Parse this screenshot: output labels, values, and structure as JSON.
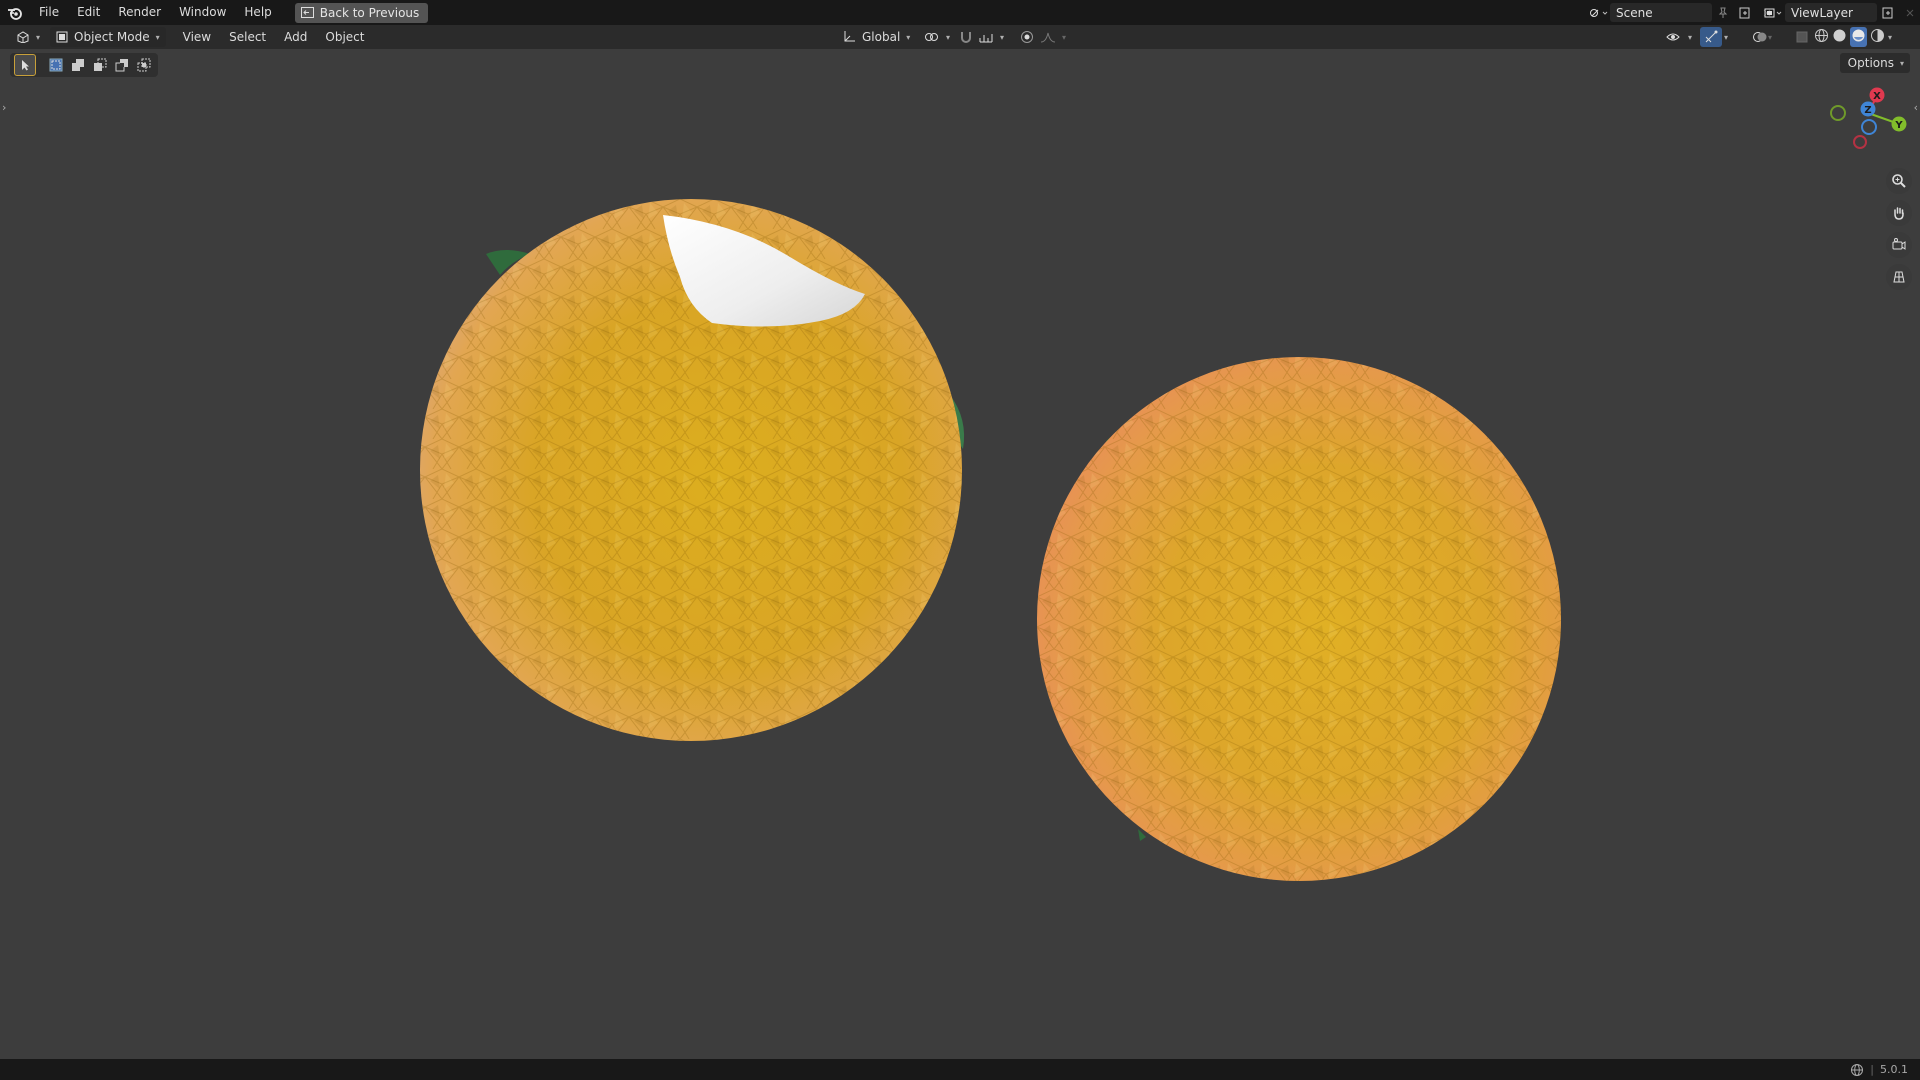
{
  "topbar": {
    "menus": [
      "File",
      "Edit",
      "Render",
      "Window",
      "Help"
    ],
    "back_button": "Back to Previous",
    "scene": "Scene",
    "view_layer": "ViewLayer"
  },
  "header": {
    "mode": "Object Mode",
    "menus": [
      "View",
      "Select",
      "Add",
      "Object"
    ],
    "orientation": "Global"
  },
  "viewport": {
    "options_label": "Options",
    "gizmo": {
      "x": "X",
      "y": "Y",
      "z": "Z"
    },
    "objects": [
      "textured orange with peel cut",
      "textured orange"
    ]
  },
  "statusbar": {
    "version": "5.0.1"
  },
  "colors": {
    "background": "#3d3d3d",
    "topbar": "#181818",
    "header": "#2b2b2b",
    "orange_light": "#f0c24a",
    "orange_edge": "#e8875e",
    "leaf": "#2f6b3c",
    "axis_x": "#e0394f",
    "axis_y": "#82bd2b",
    "axis_z": "#3f85d6"
  }
}
